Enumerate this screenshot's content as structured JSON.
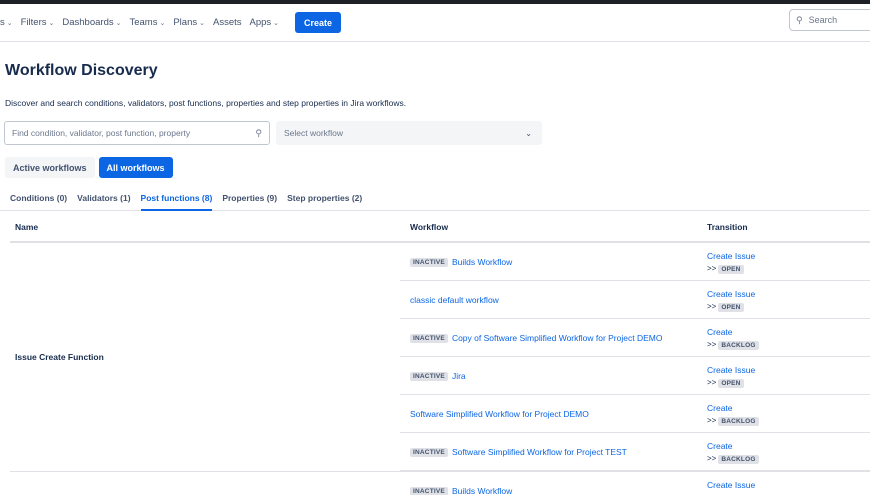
{
  "nav": {
    "items": [
      {
        "label": "s",
        "chevron": true
      },
      {
        "label": "Filters",
        "chevron": true
      },
      {
        "label": "Dashboards",
        "chevron": true
      },
      {
        "label": "Teams",
        "chevron": true
      },
      {
        "label": "Plans",
        "chevron": true
      },
      {
        "label": "Assets",
        "chevron": false
      },
      {
        "label": "Apps",
        "chevron": true
      }
    ],
    "create_label": "Create",
    "search_placeholder": "Search",
    "accent": "#0c66e4"
  },
  "page": {
    "title": "Workflow Discovery",
    "description": "Discover and search conditions, validators, post functions, properties and step properties in Jira workflows."
  },
  "filters": {
    "search_placeholder": "Find condition, validator, post function, property",
    "workflow_select_placeholder": "Select workflow"
  },
  "toggles": {
    "active": "Active workflows",
    "all": "All workflows"
  },
  "tabs": [
    {
      "label": "Conditions (0)",
      "active": false
    },
    {
      "label": "Validators (1)",
      "active": false
    },
    {
      "label": "Post functions (8)",
      "active": true
    },
    {
      "label": "Properties (9)",
      "active": false
    },
    {
      "label": "Step properties (2)",
      "active": false
    }
  ],
  "table": {
    "columns": {
      "name": "Name",
      "workflow": "Workflow",
      "transition": "Transition"
    },
    "group_name": "Issue Create Function",
    "rows": [
      {
        "inactive": true,
        "workflow": "Builds Workflow",
        "transition": "Create Issue",
        "status": "OPEN"
      },
      {
        "inactive": false,
        "workflow": "classic default workflow",
        "transition": "Create Issue",
        "status": "OPEN"
      },
      {
        "inactive": true,
        "workflow": "Copy of Software Simplified Workflow for Project DEMO",
        "transition": "Create",
        "status": "BACKLOG"
      },
      {
        "inactive": true,
        "workflow": "Jira",
        "transition": "Create Issue",
        "status": "OPEN"
      },
      {
        "inactive": false,
        "workflow": "Software Simplified Workflow for Project DEMO",
        "transition": "Create",
        "status": "BACKLOG"
      },
      {
        "inactive": true,
        "workflow": "Software Simplified Workflow for Project TEST",
        "transition": "Create",
        "status": "BACKLOG"
      }
    ],
    "next_row": {
      "inactive": true,
      "workflow": "Builds Workflow",
      "transition": "Create Issue"
    },
    "inactive_label": "INACTIVE",
    "arrow": ">>"
  }
}
